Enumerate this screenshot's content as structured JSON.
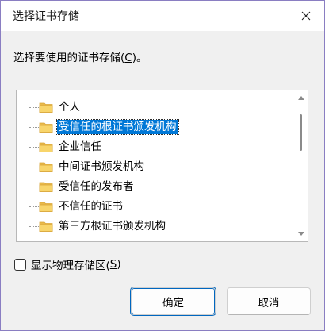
{
  "window": {
    "title": "选择证书存储",
    "close_icon": "close-icon"
  },
  "instruction": {
    "text": "选择要使用的证书存储(",
    "accel": "C",
    "suffix": ")。"
  },
  "tree": {
    "items": [
      {
        "label": "个人",
        "selected": false
      },
      {
        "label": "受信任的根证书颁发机构",
        "selected": true
      },
      {
        "label": "企业信任",
        "selected": false
      },
      {
        "label": "中间证书颁发机构",
        "selected": false
      },
      {
        "label": "受信任的发布者",
        "selected": false
      },
      {
        "label": "不信任的证书",
        "selected": false
      },
      {
        "label": "第三方根证书颁发机构",
        "selected": false
      }
    ],
    "icon": "folder-icon"
  },
  "checkbox": {
    "label": "显示物理存储区(",
    "accel": "S",
    "suffix": ")",
    "checked": false
  },
  "buttons": {
    "ok_label": "确定",
    "cancel_label": "取消"
  },
  "colors": {
    "selection": "#0078d7",
    "default_button_border": "#0067c0",
    "folder_fill": "#f8d56b",
    "folder_stroke": "#d9a63a"
  }
}
